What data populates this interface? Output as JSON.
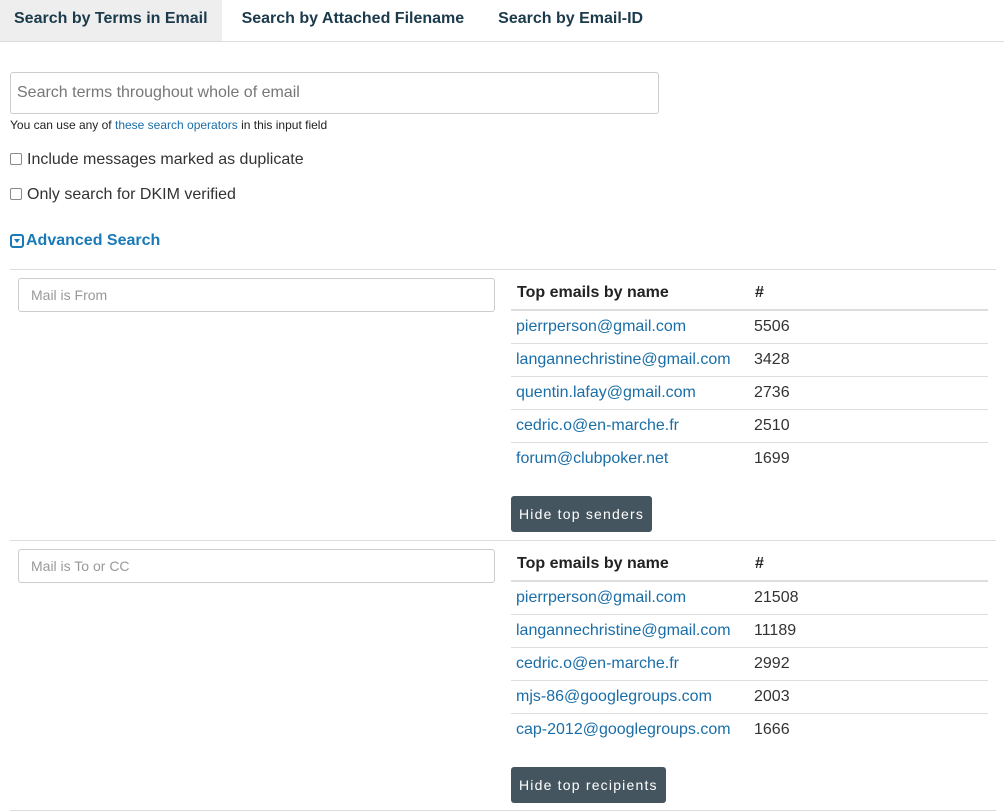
{
  "tabs": [
    {
      "label": "Search by Terms in Email",
      "active": true
    },
    {
      "label": "Search by Attached Filename",
      "active": false
    },
    {
      "label": "Search by Email-ID",
      "active": false
    }
  ],
  "search": {
    "placeholder": "Search terms throughout whole of email",
    "value": ""
  },
  "help": {
    "prefix": "You can use any of ",
    "link": "these search operators",
    "suffix": " in this input field"
  },
  "options": {
    "duplicate_label": "Include messages marked as duplicate",
    "duplicate_checked": false,
    "dkim_label": "Only search for DKIM verified",
    "dkim_checked": false
  },
  "advanced": {
    "label": "Advanced Search",
    "icon": "caret-square-down-icon"
  },
  "from_section": {
    "placeholder": "Mail is From",
    "header_name": "Top emails by name",
    "header_count": "#",
    "rows": [
      {
        "email": "pierrperson@gmail.com",
        "count": "5506"
      },
      {
        "email": "langannechristine@gmail.com",
        "count": "3428"
      },
      {
        "email": "quentin.lafay@gmail.com",
        "count": "2736"
      },
      {
        "email": "cedric.o@en-marche.fr",
        "count": "2510"
      },
      {
        "email": "forum@clubpoker.net",
        "count": "1699"
      }
    ],
    "button": "Hide top senders"
  },
  "to_section": {
    "placeholder": "Mail is To or CC",
    "header_name": "Top emails by name",
    "header_count": "#",
    "rows": [
      {
        "email": "pierrperson@gmail.com",
        "count": "21508"
      },
      {
        "email": "langannechristine@gmail.com",
        "count": "11189"
      },
      {
        "email": "cedric.o@en-marche.fr",
        "count": "2992"
      },
      {
        "email": "mjs-86@googlegroups.com",
        "count": "2003"
      },
      {
        "email": "cap-2012@googlegroups.com",
        "count": "1666"
      }
    ],
    "button": "Hide top recipients"
  },
  "colors": {
    "link": "#1a6ea8",
    "accent": "#1a7ab8",
    "button_bg": "#44555f",
    "tab_active_bg": "#eeeeee"
  }
}
